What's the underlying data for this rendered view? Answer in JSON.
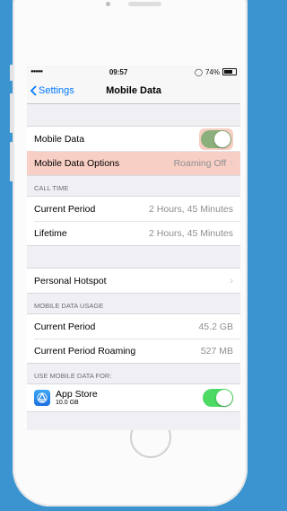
{
  "status_bar": {
    "signal": "●●●●●",
    "time": "09:57",
    "battery": "74%"
  },
  "nav": {
    "back_label": "Settings",
    "title": "Mobile Data"
  },
  "toggle_colors": {
    "on": "#4cd964",
    "highlight": "#f8cfc4"
  },
  "sections": {
    "main": {
      "mobile_data_label": "Mobile Data",
      "mobile_data_on": true,
      "options_label": "Mobile Data Options",
      "options_value": "Roaming Off"
    },
    "call_time": {
      "header": "CALL TIME",
      "rows": [
        {
          "label": "Current Period",
          "value": "2 Hours, 45 Minutes"
        },
        {
          "label": "Lifetime",
          "value": "2 Hours, 45 Minutes"
        }
      ]
    },
    "hotspot": {
      "label": "Personal Hotspot"
    },
    "usage": {
      "header": "MOBILE DATA USAGE",
      "rows": [
        {
          "label": "Current Period",
          "value": "45.2 GB"
        },
        {
          "label": "Current Period Roaming",
          "value": "527 MB"
        }
      ]
    },
    "use_for": {
      "header": "USE MOBILE DATA FOR:",
      "app_name": "App Store",
      "app_size": "10.0 GB",
      "app_on": true
    }
  }
}
